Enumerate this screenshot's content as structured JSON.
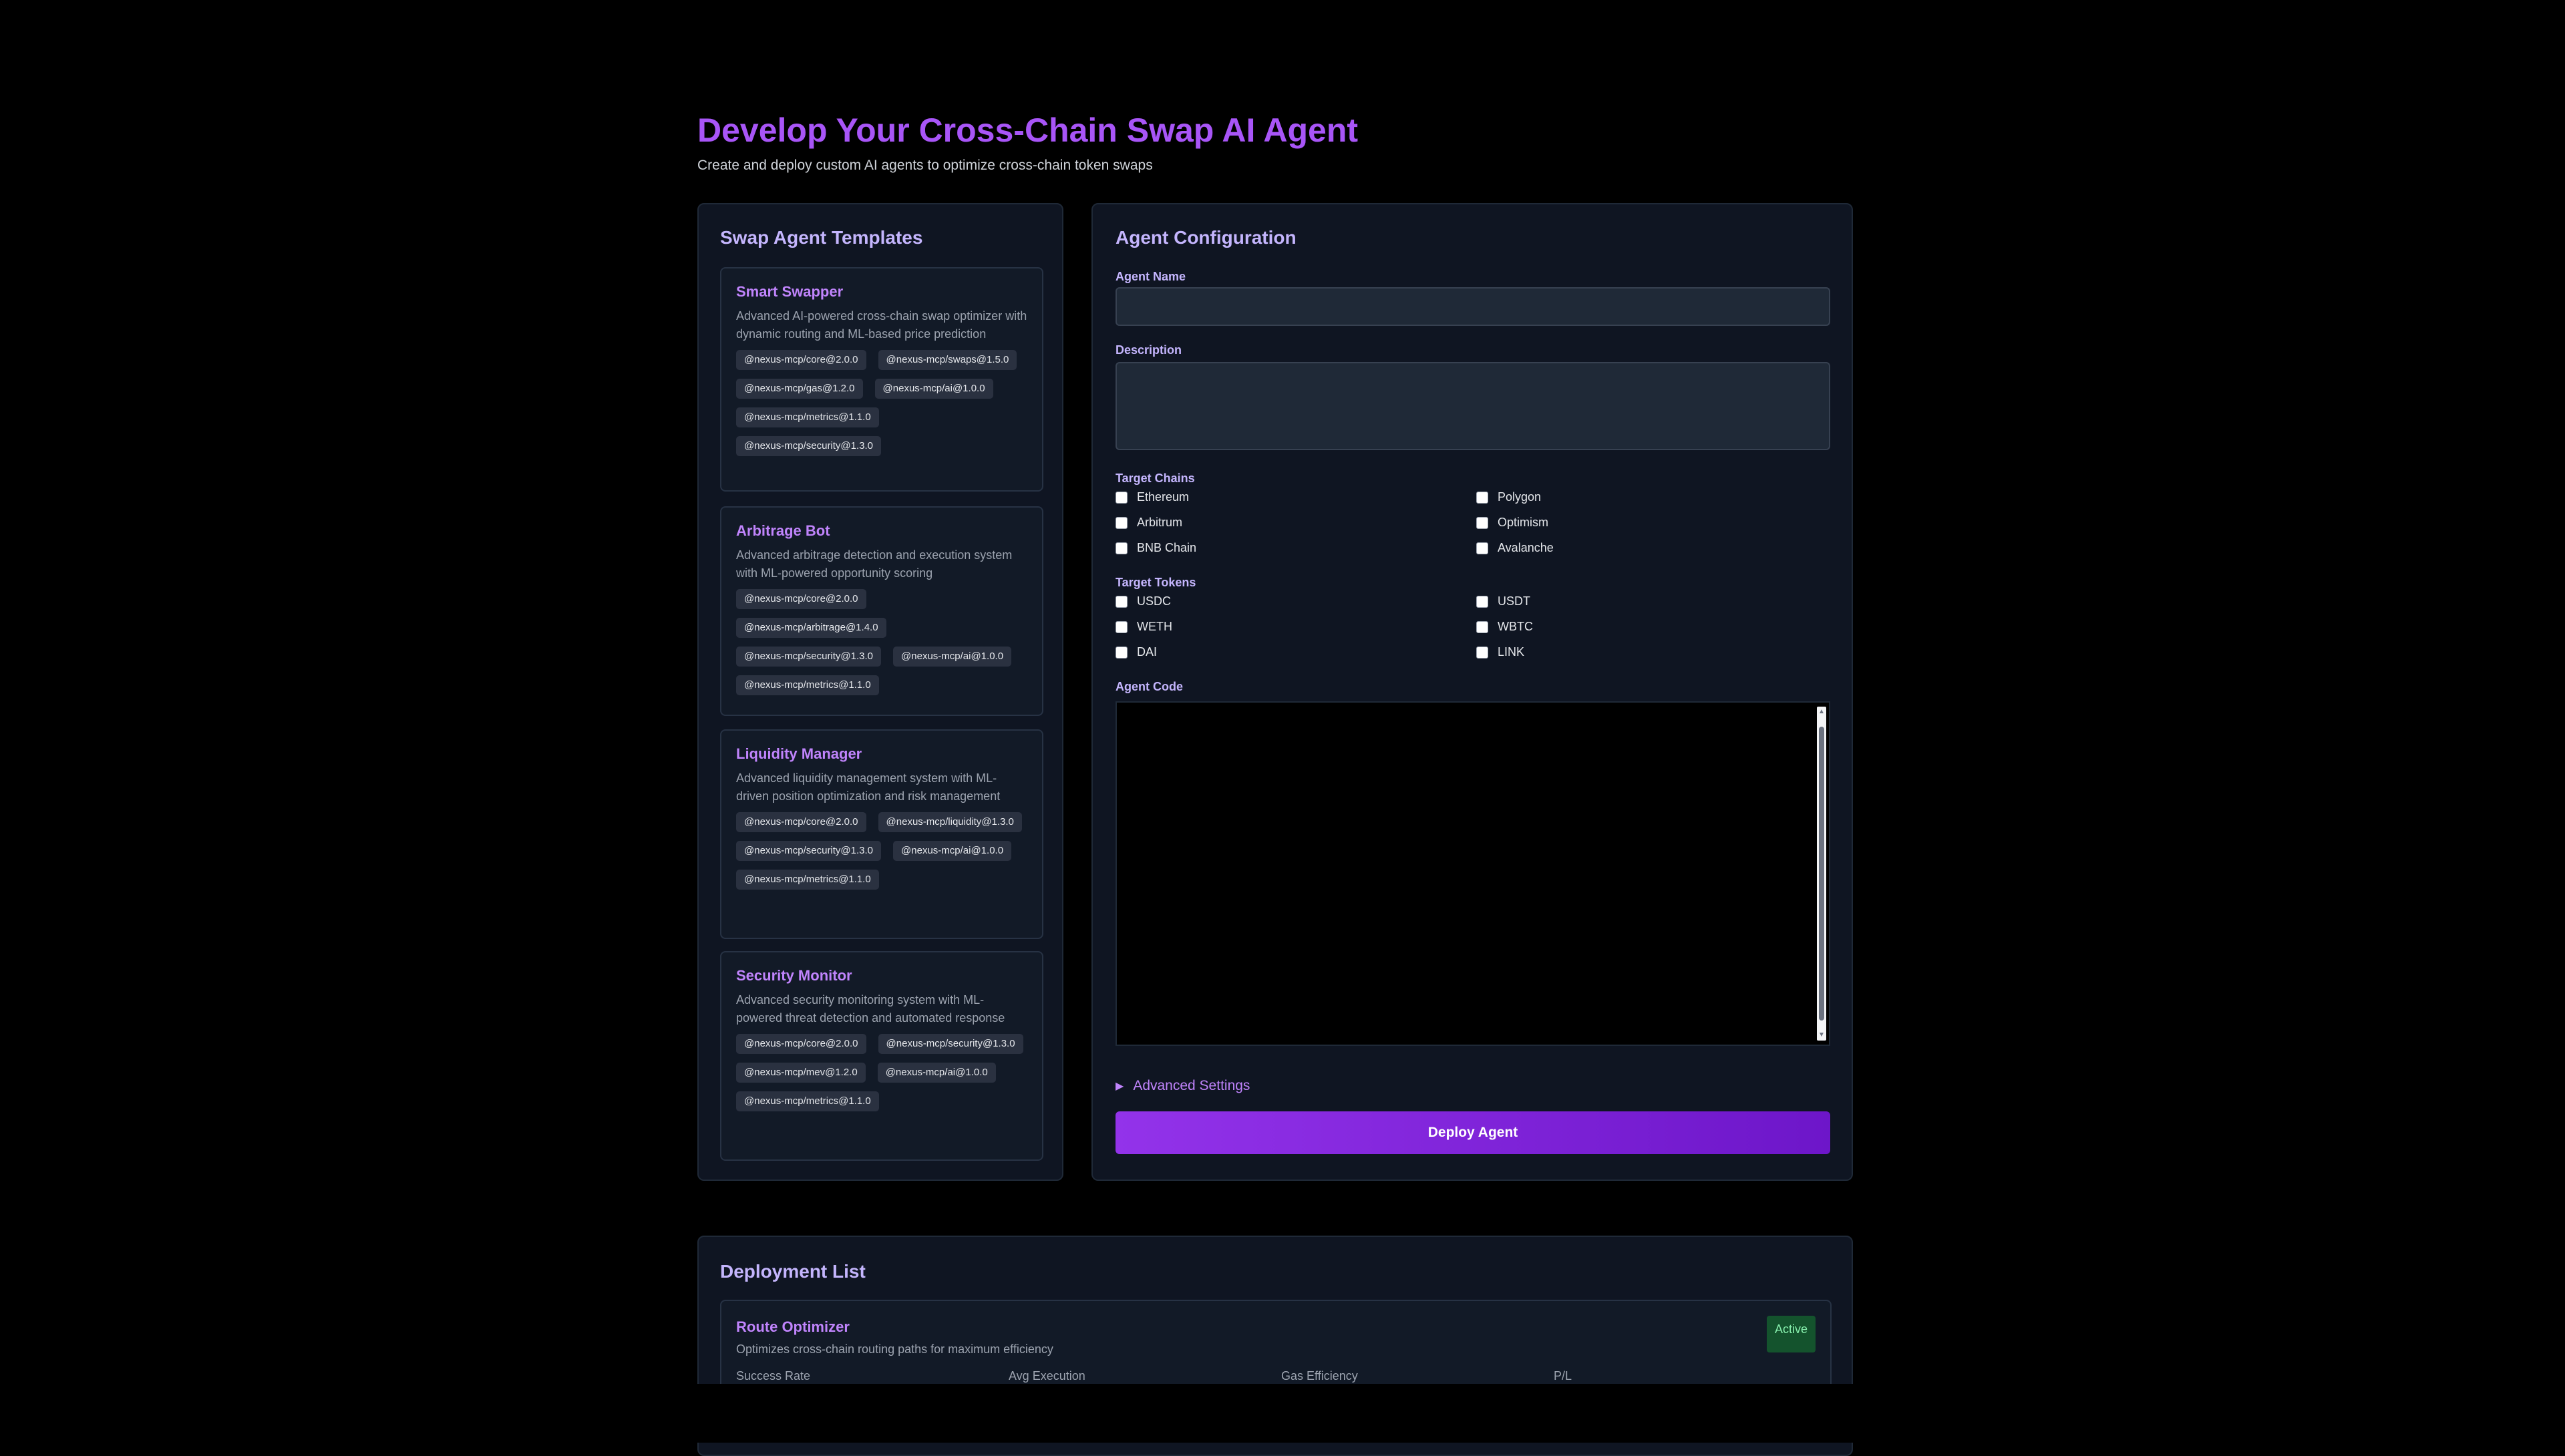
{
  "header": {
    "title": "Develop Your Cross-Chain Swap AI Agent",
    "subtitle": "Create and deploy custom AI agents to optimize cross-chain token swaps"
  },
  "templates": {
    "title": "Swap Agent Templates",
    "items": [
      {
        "name": "Smart Swapper",
        "description": "Advanced AI-powered cross-chain swap optimizer with dynamic routing and ML-based price prediction",
        "tags": [
          "@nexus-mcp/core@2.0.0",
          "@nexus-mcp/swaps@1.5.0",
          "@nexus-mcp/gas@1.2.0",
          "@nexus-mcp/ai@1.0.0",
          "@nexus-mcp/metrics@1.1.0",
          "@nexus-mcp/security@1.3.0"
        ]
      },
      {
        "name": "Arbitrage Bot",
        "description": "Advanced arbitrage detection and execution system with ML-powered opportunity scoring",
        "tags": [
          "@nexus-mcp/core@2.0.0",
          "@nexus-mcp/arbitrage@1.4.0",
          "@nexus-mcp/security@1.3.0",
          "@nexus-mcp/ai@1.0.0",
          "@nexus-mcp/metrics@1.1.0"
        ]
      },
      {
        "name": "Liquidity Manager",
        "description": "Advanced liquidity management system with ML-driven position optimization and risk management",
        "tags": [
          "@nexus-mcp/core@2.0.0",
          "@nexus-mcp/liquidity@1.3.0",
          "@nexus-mcp/security@1.3.0",
          "@nexus-mcp/ai@1.0.0",
          "@nexus-mcp/metrics@1.1.0"
        ]
      },
      {
        "name": "Security Monitor",
        "description": "Advanced security monitoring system with ML-powered threat detection and automated response",
        "tags": [
          "@nexus-mcp/core@2.0.0",
          "@nexus-mcp/security@1.3.0",
          "@nexus-mcp/mev@1.2.0",
          "@nexus-mcp/ai@1.0.0",
          "@nexus-mcp/metrics@1.1.0"
        ]
      }
    ]
  },
  "config": {
    "title": "Agent Configuration",
    "agent_name_label": "Agent Name",
    "agent_name_value": "",
    "description_label": "Description",
    "description_value": "",
    "chains_label": "Target Chains",
    "chains": [
      "Ethereum",
      "Polygon",
      "Arbitrum",
      "Optimism",
      "BNB Chain",
      "Avalanche"
    ],
    "tokens_label": "Target Tokens",
    "tokens": [
      "USDC",
      "USDT",
      "WETH",
      "WBTC",
      "DAI",
      "LINK"
    ],
    "code_label": "Agent Code",
    "advanced_label": "Advanced Settings",
    "deploy_label": "Deploy Agent"
  },
  "deployments": {
    "title": "Deployment List",
    "items": [
      {
        "name": "Route Optimizer",
        "description": "Optimizes cross-chain routing paths for maximum efficiency",
        "status": "Active",
        "metric_labels": [
          "Success Rate",
          "Avg Execution",
          "Gas Efficiency",
          "P/L"
        ]
      }
    ]
  },
  "colors": {
    "accent": "#a855f7",
    "background": "#000000",
    "panel": "#0f1522",
    "active_badge": "#14532d"
  }
}
